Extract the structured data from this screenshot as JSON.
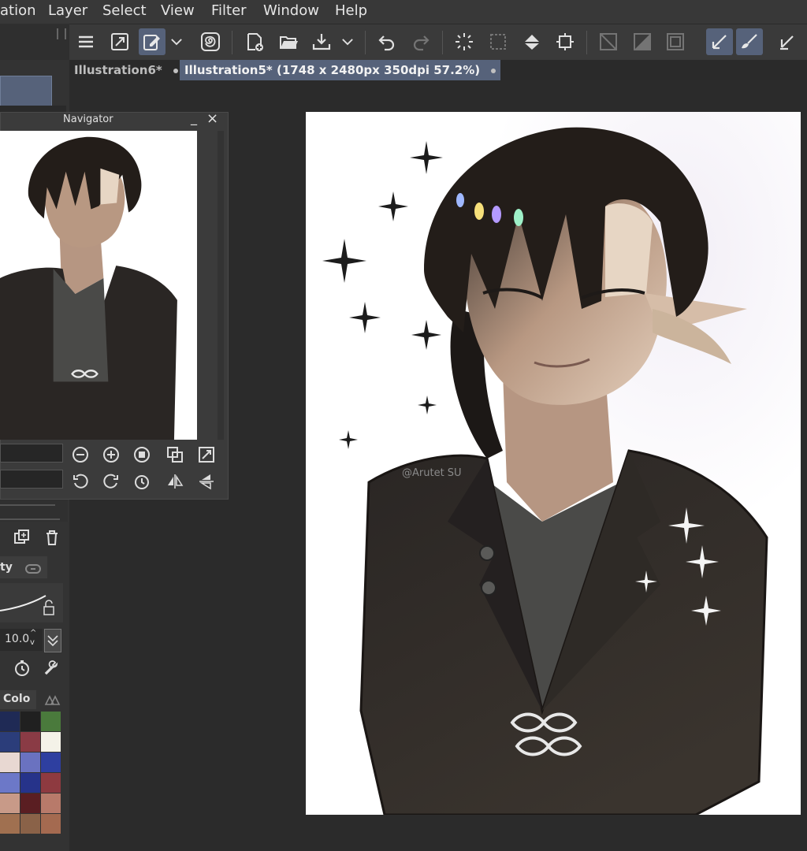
{
  "menubar": {
    "items": [
      "ation",
      "Layer",
      "Select",
      "View",
      "Filter",
      "Window",
      "Help"
    ]
  },
  "toolbar": {
    "icons": [
      "menu-icon",
      "expand-icon",
      "edit-layer-icon",
      "chevron-down-icon",
      "spiral-icon",
      "new-file-icon",
      "open-folder-icon",
      "save-icon",
      "chevron-down-icon",
      "undo-icon",
      "redo-icon",
      "loading-icon",
      "transform-icon",
      "fill-icon",
      "crop-icon",
      "ruler-icon",
      "gradient-icon",
      "frame-icon",
      "pen-icon",
      "brush-icon",
      "pencil-icon"
    ]
  },
  "tabs": [
    {
      "label": "Illustration6*",
      "active": false
    },
    {
      "label": "Illustration5* (1748 x 2480px 350dpi 57.2%)",
      "active": true
    }
  ],
  "navigator": {
    "title": "Navigator",
    "min_glyph": "_",
    "close_glyph": "×",
    "buttons_row1": [
      "zoom-out-icon",
      "zoom-in-icon",
      "fit-icon",
      "actual-size-icon",
      "fullscreen-icon"
    ],
    "buttons_row2": [
      "rotate-left-icon",
      "rotate-right-icon",
      "reset-rotation-icon",
      "flip-horizontal-icon",
      "flip-vertical-icon"
    ]
  },
  "left_panel": {
    "tab_label": "ty",
    "brush_size": "10.0",
    "color_tab_label": "Colo",
    "colors": [
      "#1f2a55",
      "#202020",
      "#4a7a3c",
      "#2b3d7a",
      "#8a3b45",
      "#f4f2e8",
      "#e8d8d2",
      "#6a72c0",
      "#2e3fa0",
      "#6c78c8",
      "#26338a",
      "#8e3a40",
      "#c89a88",
      "#5a1e22",
      "#b87a6a",
      "#a07050",
      "#8a6248",
      "#a46a50"
    ]
  },
  "canvas": {
    "background": "#ffffff",
    "watermark": "@Arutet SU"
  }
}
